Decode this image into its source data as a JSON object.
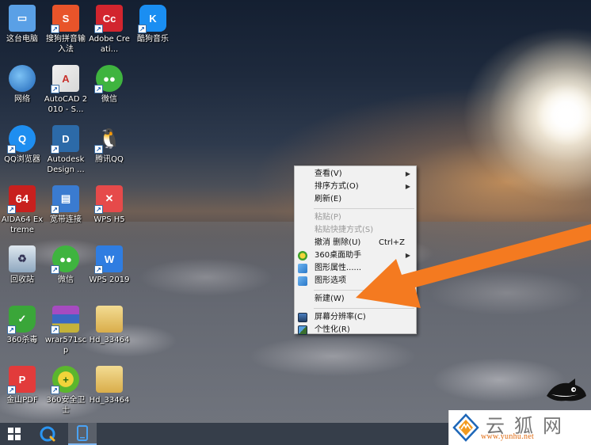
{
  "desktop": {
    "icons": [
      {
        "label": "这台电脑",
        "icon": "computer-icon",
        "color": "#5aa0e6"
      },
      {
        "label": "搜狗拼音输入法",
        "icon": "sogou-icon",
        "color": "#e8542a"
      },
      {
        "label": "Adobe Creati...",
        "icon": "adobe-cc-icon",
        "color": "#d2252e"
      },
      {
        "label": "酷狗音乐",
        "icon": "kugou-icon",
        "color": "#1a8ef2"
      },
      {
        "label": "网络",
        "icon": "network-icon",
        "color": "#3f86d8"
      },
      {
        "label": "AutoCAD 2010 - S...",
        "icon": "autocad-icon",
        "color": "#c8302b"
      },
      {
        "label": "微信",
        "icon": "wechat-icon",
        "color": "#3fb43f"
      },
      {
        "label": "QQ浏览器",
        "icon": "qq-browser-icon",
        "color": "#1e8ef0"
      },
      {
        "label": "Autodesk Design ...",
        "icon": "autodesk-design-icon",
        "color": "#2c6aa8"
      },
      {
        "label": "腾讯QQ",
        "icon": "qq-icon",
        "color": "#1b1b1b"
      },
      {
        "label": "AIDA64 Extreme",
        "icon": "aida64-icon",
        "color": "#c8201e"
      },
      {
        "label": "宽带连接",
        "icon": "broadband-icon",
        "color": "#3a7bd0"
      },
      {
        "label": "WPS H5",
        "icon": "wps-h5-icon",
        "color": "#e64a4a"
      },
      {
        "label": "回收站",
        "icon": "recycle-bin-icon",
        "color": "#8ea7bf"
      },
      {
        "label": "微信",
        "icon": "wechat-icon",
        "color": "#3fb43f"
      },
      {
        "label": "WPS 2019",
        "icon": "wps-icon",
        "color": "#2f7de1"
      },
      {
        "label": "360杀毒",
        "icon": "360-antivirus-icon",
        "color": "#3aa639"
      },
      {
        "label": "wrar571scp",
        "icon": "winrar-icon",
        "color": "#7a3a8c"
      },
      {
        "label": "Hd_33464",
        "icon": "folder-icon",
        "color": "#e6c36a"
      },
      {
        "label": "金山PDF",
        "icon": "kingsoft-pdf-icon",
        "color": "#e23b3b"
      },
      {
        "label": "360安全卫士",
        "icon": "360-security-icon",
        "color": "#5bb62d"
      },
      {
        "label": "Hd_33464",
        "icon": "folder-icon",
        "color": "#e6c36a"
      }
    ]
  },
  "context_menu": {
    "items": [
      {
        "label": "查看(V)",
        "submenu": true
      },
      {
        "label": "排序方式(O)",
        "submenu": true
      },
      {
        "label": "刷新(E)"
      },
      {
        "label": "粘贴(P)",
        "disabled": true
      },
      {
        "label": "粘贴快捷方式(S)",
        "disabled": true
      },
      {
        "label": "撤消 删除(U)",
        "shortcut": "Ctrl+Z"
      },
      {
        "label": "360桌面助手",
        "submenu": true,
        "icon": "360-desktop-icon"
      },
      {
        "label": "图形属性......",
        "icon": "graphics-properties-icon"
      },
      {
        "label": "图形选项",
        "icon": "graphics-options-icon"
      },
      {
        "label": "新建(W)",
        "submenu": true
      },
      {
        "label": "屏幕分辨率(C)",
        "icon": "screen-resolution-icon"
      },
      {
        "label": "个性化(R)",
        "icon": "personalize-icon"
      }
    ]
  },
  "watermark": {
    "title": "云狐网",
    "url": "www.yunhu.net"
  },
  "colors": {
    "arrow": "#f47a20",
    "taskbar": "#363e4a",
    "menu_bg": "#f1f1f1"
  }
}
